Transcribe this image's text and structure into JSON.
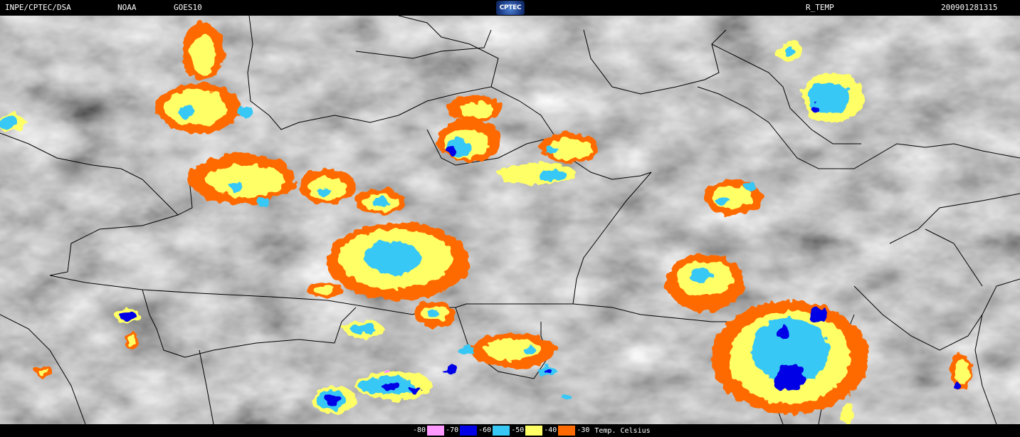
{
  "header": {
    "agency": "INPE/CPTEC/DSA",
    "source": "NOAA",
    "satellite": "GOES10",
    "logo_text": "CPTEC",
    "product": "R_TEMP",
    "datetime": "200901281315"
  },
  "legend": {
    "unit": "Temp. Celsius",
    "entries": [
      {
        "label": "-80",
        "color": "#ff99ff"
      },
      {
        "label": "-70",
        "color": "#0000e6"
      },
      {
        "label": "-60",
        "color": "#38c8f5"
      },
      {
        "label": "-50",
        "color": "#ffff66"
      },
      {
        "label": "-40",
        "color": "#ff6a00"
      },
      {
        "label": "-30",
        "color": ""
      }
    ]
  },
  "colors": {
    "cloud_gray": "#808080",
    "boundary": "#000000"
  }
}
